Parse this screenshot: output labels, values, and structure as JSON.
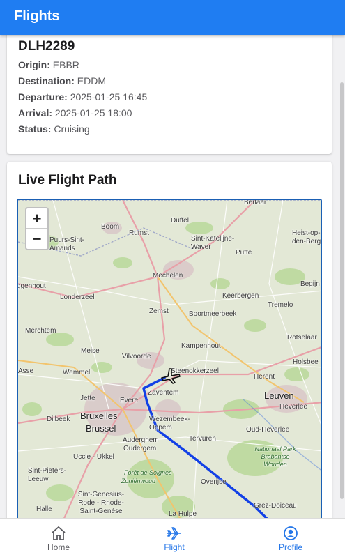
{
  "app_bar": {
    "title": "Flights"
  },
  "flight": {
    "callsign": "DLH2289",
    "fields": [
      {
        "label": "Origin:",
        "value": "EBBR"
      },
      {
        "label": "Destination:",
        "value": "EDDM"
      },
      {
        "label": "Departure:",
        "value": "2025-01-25 16:45"
      },
      {
        "label": "Arrival:",
        "value": "2025-01-25 18:00"
      },
      {
        "label": "Status:",
        "value": "Cruising"
      }
    ]
  },
  "map_section": {
    "title": "Live Flight Path",
    "zoom_in": "+",
    "zoom_out": "−",
    "places": [
      "Berlaar",
      "Boom",
      "Rumst",
      "Duffel",
      "Puurs-Sint-Amands",
      "Sint-Katelijne-Waver",
      "Heist-op-den-Berg",
      "Putte",
      "Mechelen",
      "ggenhout",
      "Londerzeel",
      "Begijn",
      "Keerbergen",
      "Tremelo",
      "Zemst",
      "Boortmeerbeek",
      "Merchtem",
      "Rotselaar",
      "Kampenhout",
      "Meise",
      "Holsbee",
      "Vilvoorde",
      "Steenokkerzeel",
      "Asse",
      "Wemmel",
      "Herent",
      "Leuven",
      "Zaventem",
      "Jette",
      "Evere",
      "Heverlee",
      "Dilbeek",
      "Bruxelles",
      "Brussel",
      "Wezembeek-Oppem",
      "Oud-Heverlee",
      "Auderghem",
      "Oudergem",
      "Tervuren",
      "Uccle - Ukkel",
      "Nationaal Park Brabantse Wouden",
      "Sint-Pieters-Leeuw",
      "Forêt de Soignes",
      "Zoniënwoud",
      "Overijse",
      "Sint-Genesius-Rode - Rhode-Saint-Genèse",
      "Grez-Doiceau",
      "Halle",
      "La Hulpe"
    ],
    "colors": {
      "flight_path": "#1240e6",
      "frame": "#1a5fb4"
    }
  },
  "bottom_nav": [
    {
      "label": "Home",
      "icon": "home-icon"
    },
    {
      "label": "Flight",
      "icon": "airplane-icon"
    },
    {
      "label": "Profile",
      "icon": "profile-icon"
    }
  ]
}
